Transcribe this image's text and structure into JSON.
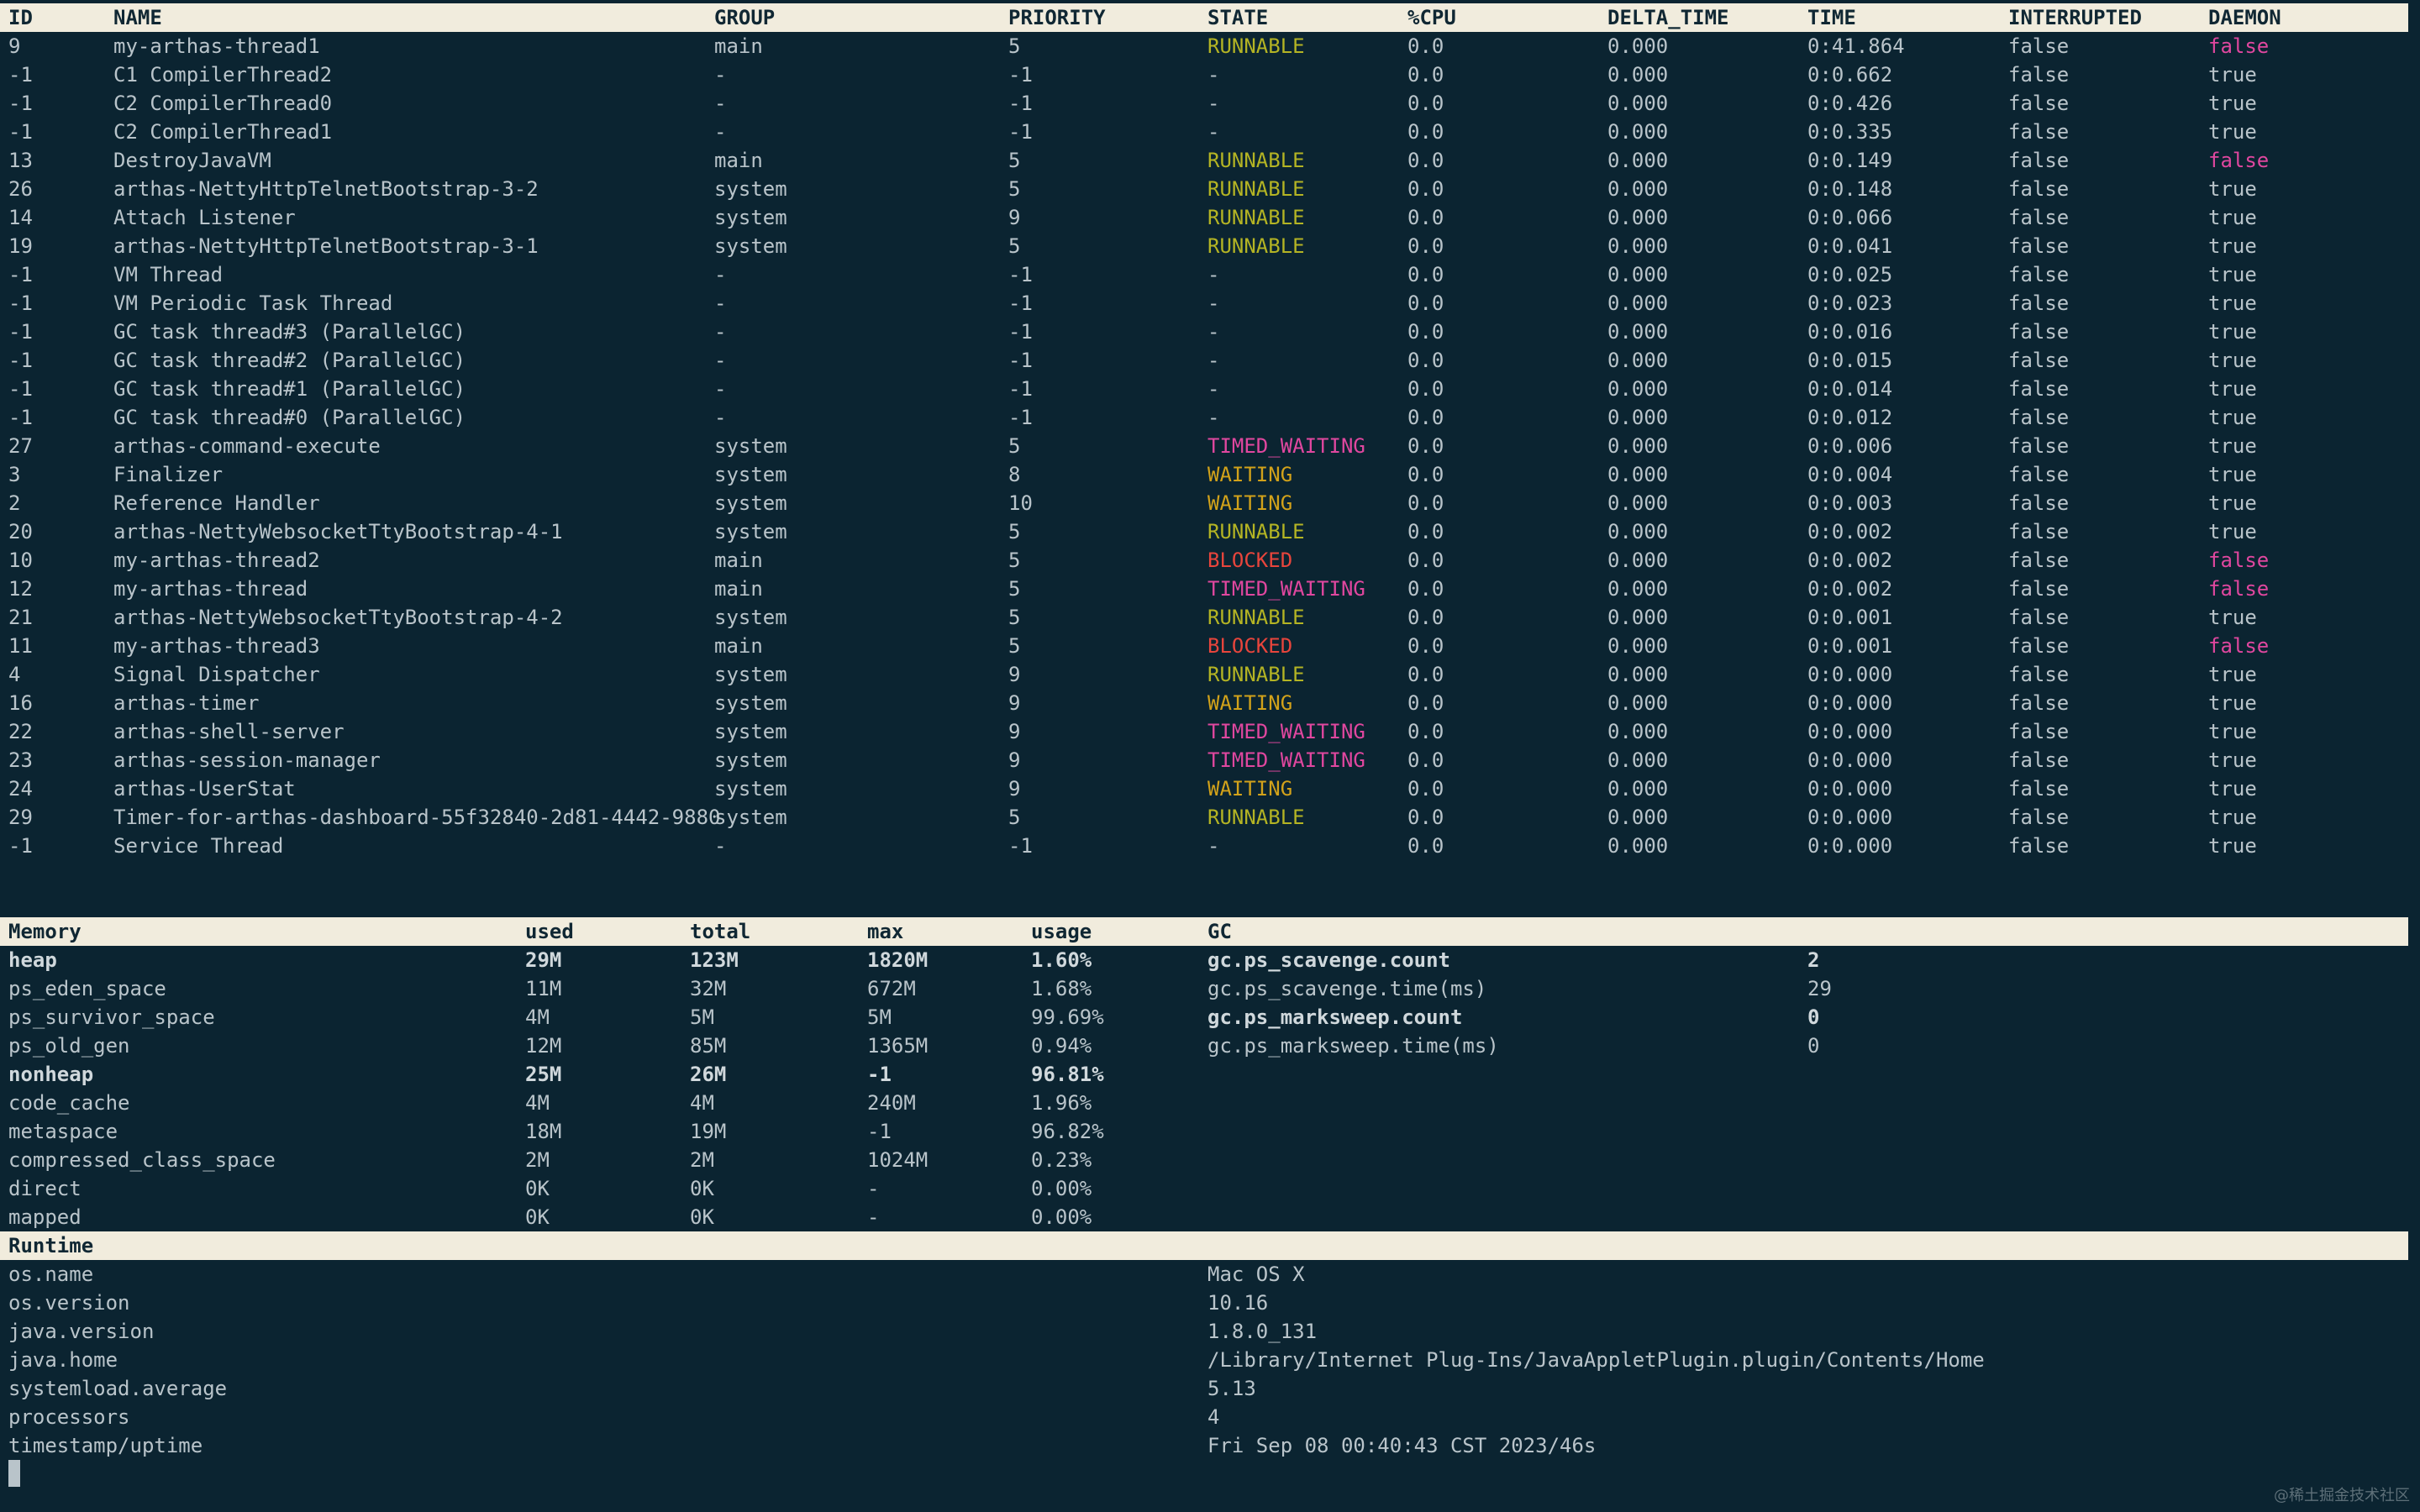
{
  "threads": {
    "headers": [
      "ID",
      "NAME",
      "GROUP",
      "PRIORITY",
      "STATE",
      "%CPU",
      "DELTA_TIME",
      "TIME",
      "INTERRUPTED",
      "DAEMON"
    ],
    "rows": [
      [
        "9",
        "my-arthas-thread1",
        "main",
        "5",
        "RUNNABLE",
        "0.0",
        "0.000",
        "0:41.864",
        "false",
        "false"
      ],
      [
        "-1",
        "C1 CompilerThread2",
        "-",
        "-1",
        "-",
        "0.0",
        "0.000",
        "0:0.662",
        "false",
        "true"
      ],
      [
        "-1",
        "C2 CompilerThread0",
        "-",
        "-1",
        "-",
        "0.0",
        "0.000",
        "0:0.426",
        "false",
        "true"
      ],
      [
        "-1",
        "C2 CompilerThread1",
        "-",
        "-1",
        "-",
        "0.0",
        "0.000",
        "0:0.335",
        "false",
        "true"
      ],
      [
        "13",
        "DestroyJavaVM",
        "main",
        "5",
        "RUNNABLE",
        "0.0",
        "0.000",
        "0:0.149",
        "false",
        "false"
      ],
      [
        "26",
        "arthas-NettyHttpTelnetBootstrap-3-2",
        "system",
        "5",
        "RUNNABLE",
        "0.0",
        "0.000",
        "0:0.148",
        "false",
        "true"
      ],
      [
        "14",
        "Attach Listener",
        "system",
        "9",
        "RUNNABLE",
        "0.0",
        "0.000",
        "0:0.066",
        "false",
        "true"
      ],
      [
        "19",
        "arthas-NettyHttpTelnetBootstrap-3-1",
        "system",
        "5",
        "RUNNABLE",
        "0.0",
        "0.000",
        "0:0.041",
        "false",
        "true"
      ],
      [
        "-1",
        "VM Thread",
        "-",
        "-1",
        "-",
        "0.0",
        "0.000",
        "0:0.025",
        "false",
        "true"
      ],
      [
        "-1",
        "VM Periodic Task Thread",
        "-",
        "-1",
        "-",
        "0.0",
        "0.000",
        "0:0.023",
        "false",
        "true"
      ],
      [
        "-1",
        "GC task thread#3 (ParallelGC)",
        "-",
        "-1",
        "-",
        "0.0",
        "0.000",
        "0:0.016",
        "false",
        "true"
      ],
      [
        "-1",
        "GC task thread#2 (ParallelGC)",
        "-",
        "-1",
        "-",
        "0.0",
        "0.000",
        "0:0.015",
        "false",
        "true"
      ],
      [
        "-1",
        "GC task thread#1 (ParallelGC)",
        "-",
        "-1",
        "-",
        "0.0",
        "0.000",
        "0:0.014",
        "false",
        "true"
      ],
      [
        "-1",
        "GC task thread#0 (ParallelGC)",
        "-",
        "-1",
        "-",
        "0.0",
        "0.000",
        "0:0.012",
        "false",
        "true"
      ],
      [
        "27",
        "arthas-command-execute",
        "system",
        "5",
        "TIMED_WAITING",
        "0.0",
        "0.000",
        "0:0.006",
        "false",
        "true"
      ],
      [
        "3",
        "Finalizer",
        "system",
        "8",
        "WAITING",
        "0.0",
        "0.000",
        "0:0.004",
        "false",
        "true"
      ],
      [
        "2",
        "Reference Handler",
        "system",
        "10",
        "WAITING",
        "0.0",
        "0.000",
        "0:0.003",
        "false",
        "true"
      ],
      [
        "20",
        "arthas-NettyWebsocketTtyBootstrap-4-1",
        "system",
        "5",
        "RUNNABLE",
        "0.0",
        "0.000",
        "0:0.002",
        "false",
        "true"
      ],
      [
        "10",
        "my-arthas-thread2",
        "main",
        "5",
        "BLOCKED",
        "0.0",
        "0.000",
        "0:0.002",
        "false",
        "false"
      ],
      [
        "12",
        "my-arthas-thread",
        "main",
        "5",
        "TIMED_WAITING",
        "0.0",
        "0.000",
        "0:0.002",
        "false",
        "false"
      ],
      [
        "21",
        "arthas-NettyWebsocketTtyBootstrap-4-2",
        "system",
        "5",
        "RUNNABLE",
        "0.0",
        "0.000",
        "0:0.001",
        "false",
        "true"
      ],
      [
        "11",
        "my-arthas-thread3",
        "main",
        "5",
        "BLOCKED",
        "0.0",
        "0.000",
        "0:0.001",
        "false",
        "false"
      ],
      [
        "4",
        "Signal Dispatcher",
        "system",
        "9",
        "RUNNABLE",
        "0.0",
        "0.000",
        "0:0.000",
        "false",
        "true"
      ],
      [
        "16",
        "arthas-timer",
        "system",
        "9",
        "WAITING",
        "0.0",
        "0.000",
        "0:0.000",
        "false",
        "true"
      ],
      [
        "22",
        "arthas-shell-server",
        "system",
        "9",
        "TIMED_WAITING",
        "0.0",
        "0.000",
        "0:0.000",
        "false",
        "true"
      ],
      [
        "23",
        "arthas-session-manager",
        "system",
        "9",
        "TIMED_WAITING",
        "0.0",
        "0.000",
        "0:0.000",
        "false",
        "true"
      ],
      [
        "24",
        "arthas-UserStat",
        "system",
        "9",
        "WAITING",
        "0.0",
        "0.000",
        "0:0.000",
        "false",
        "true"
      ],
      [
        "29",
        "Timer-for-arthas-dashboard-55f32840-2d81-4442-9880",
        "system",
        "5",
        "RUNNABLE",
        "0.0",
        "0.000",
        "0:0.000",
        "false",
        "true"
      ],
      [
        "-1",
        "Service Thread",
        "-",
        "-1",
        "-",
        "0.0",
        "0.000",
        "0:0.000",
        "false",
        "true"
      ]
    ]
  },
  "memory": {
    "headers": [
      "Memory",
      "used",
      "total",
      "max",
      "usage"
    ],
    "rows": [
      {
        "cells": [
          "heap",
          "29M",
          "123M",
          "1820M",
          "1.60%"
        ],
        "bold": true
      },
      {
        "cells": [
          "ps_eden_space",
          "11M",
          "32M",
          "672M",
          "1.68%"
        ],
        "bold": false
      },
      {
        "cells": [
          "ps_survivor_space",
          "4M",
          "5M",
          "5M",
          "99.69%"
        ],
        "bold": false
      },
      {
        "cells": [
          "ps_old_gen",
          "12M",
          "85M",
          "1365M",
          "0.94%"
        ],
        "bold": false
      },
      {
        "cells": [
          "nonheap",
          "25M",
          "26M",
          "-1",
          "96.81%"
        ],
        "bold": true
      },
      {
        "cells": [
          "code_cache",
          "4M",
          "4M",
          "240M",
          "1.96%"
        ],
        "bold": false
      },
      {
        "cells": [
          "metaspace",
          "18M",
          "19M",
          "-1",
          "96.82%"
        ],
        "bold": false
      },
      {
        "cells": [
          "compressed_class_space",
          "2M",
          "2M",
          "1024M",
          "0.23%"
        ],
        "bold": false
      },
      {
        "cells": [
          "direct",
          "0K",
          "0K",
          "-",
          "0.00%"
        ],
        "bold": false
      },
      {
        "cells": [
          "mapped",
          "0K",
          "0K",
          "-",
          "0.00%"
        ],
        "bold": false
      }
    ]
  },
  "gc": {
    "header": "GC",
    "rows": [
      {
        "cells": [
          "gc.ps_scavenge.count",
          "2"
        ],
        "bold": true
      },
      {
        "cells": [
          "gc.ps_scavenge.time(ms)",
          "29"
        ],
        "bold": false
      },
      {
        "cells": [
          "gc.ps_marksweep.count",
          "0"
        ],
        "bold": true
      },
      {
        "cells": [
          "gc.ps_marksweep.time(ms)",
          "0"
        ],
        "bold": false
      }
    ]
  },
  "runtime": {
    "header": "Runtime",
    "rows": [
      [
        "os.name",
        "Mac OS X"
      ],
      [
        "os.version",
        "10.16"
      ],
      [
        "java.version",
        "1.8.0_131"
      ],
      [
        "java.home",
        "/Library/Internet Plug-Ins/JavaAppletPlugin.plugin/Contents/Home"
      ],
      [
        "systemload.average",
        "5.13"
      ],
      [
        "processors",
        "4"
      ],
      [
        "timestamp/uptime",
        "Fri Sep 08 00:40:43 CST 2023/46s"
      ]
    ]
  },
  "watermark": "@稀土掘金技术社区",
  "colors": {
    "background": "#0b2431",
    "header_bg": "#f1ecdd",
    "text": "#b9c4ca",
    "runnable": "#b4b424",
    "timed_waiting": "#e0479f",
    "waiting": "#d2a21a",
    "blocked": "#e8453c",
    "daemon_false": "#e0479f"
  }
}
